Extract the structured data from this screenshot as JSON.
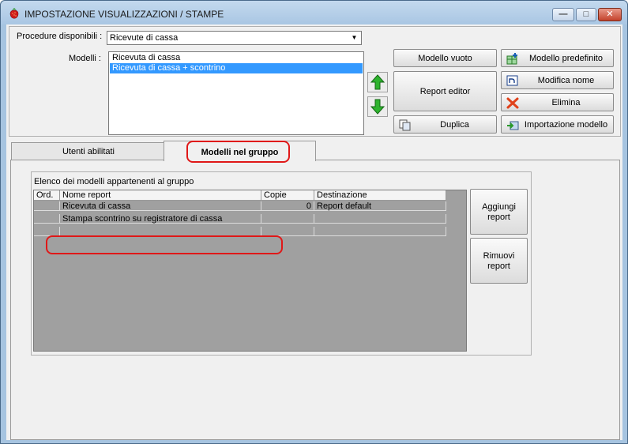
{
  "window": {
    "title": "IMPOSTAZIONE VISUALIZZAZIONI / STAMPE",
    "minimize_glyph": "—",
    "maximize_glyph": "□",
    "close_glyph": "✕"
  },
  "form": {
    "procedure_label": "Procedure disponibili :",
    "procedure_value": "Ricevute di cassa",
    "modelli_label": "Modelli :",
    "modelli": [
      "Ricevuta di cassa",
      "Ricevuta di cassa + scontrino"
    ],
    "selected_modello": "Ricevuta di cassa + scontrino"
  },
  "buttons": {
    "modello_vuoto": "Modello vuoto",
    "modello_predefinito": "Modello predefinito",
    "report_editor": "Report editor",
    "modifica_nome": "Modifica nome",
    "elimina": "Elimina",
    "duplica": "Duplica",
    "importazione_modello": "Importazione modello"
  },
  "tabs": [
    {
      "label": "Utenti abilitati",
      "active": false
    },
    {
      "label": "Modelli nel gruppo",
      "active": true
    }
  ],
  "group": {
    "title": "Elenco dei modelli appartenenti al gruppo",
    "columns": [
      "Ord.",
      "Nome report",
      "Copie",
      "Destinazione"
    ],
    "rows": [
      {
        "ord": "",
        "nome": "Ricevuta di cassa",
        "copie": "0",
        "destinazione": "Report default"
      },
      {
        "ord": "",
        "nome": "Stampa scontrino su registratore di cassa",
        "copie": "",
        "destinazione": ""
      }
    ]
  },
  "side_buttons": {
    "aggiungi_line1": "Aggiungi",
    "aggiungi_line2": "report",
    "rimuovi_line1": "Rimuovi",
    "rimuovi_line2": "report"
  },
  "colors": {
    "selection": "#3399ff",
    "annotation": "#e01818",
    "arrow_green": "#2db32d"
  },
  "icons": [
    "strawberry-icon",
    "arrow-up-icon",
    "arrow-down-icon",
    "add-table-icon",
    "rename-icon",
    "delete-x-icon",
    "copy-icon",
    "import-icon"
  ]
}
